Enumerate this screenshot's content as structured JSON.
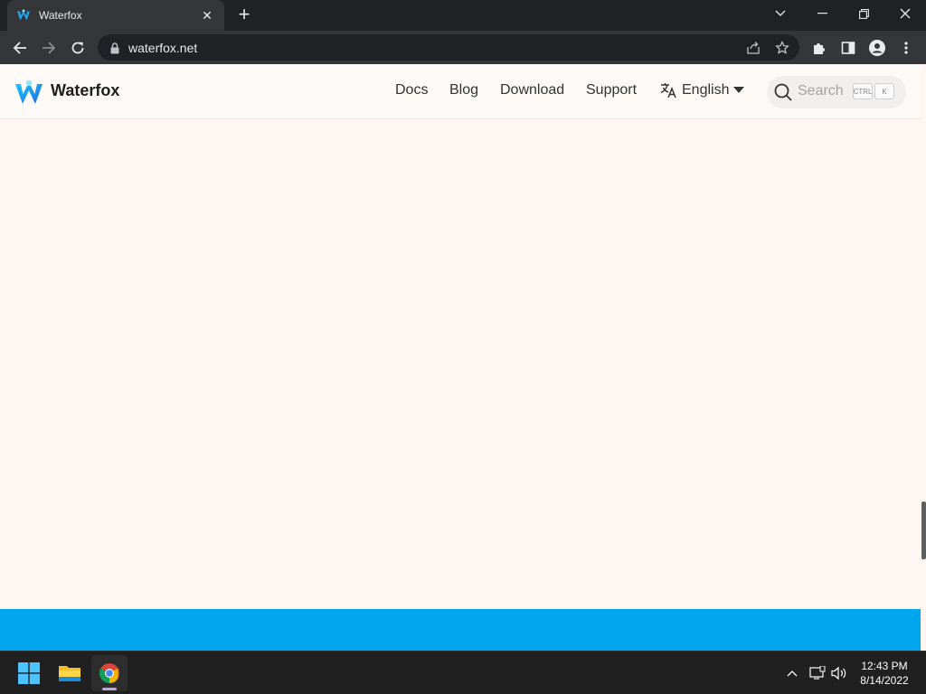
{
  "browser": {
    "tab": {
      "title": "Waterfox"
    },
    "address_bar": {
      "url": "waterfox.net"
    }
  },
  "site": {
    "brand": "Waterfox",
    "nav": [
      {
        "label": "Docs"
      },
      {
        "label": "Blog"
      },
      {
        "label": "Download"
      },
      {
        "label": "Support"
      }
    ],
    "language": {
      "label": "English"
    },
    "search": {
      "placeholder": "Search",
      "shortcut_keys": [
        "CTRL",
        "K"
      ]
    },
    "colors": {
      "accent_band": "#00a6ed",
      "page_background": "#fdf6f3"
    }
  },
  "taskbar": {
    "clock": {
      "time": "12:43 PM",
      "date": "8/14/2022"
    }
  },
  "icons": [
    "waterfox-logo-icon",
    "close-icon",
    "plus-icon",
    "chevron-down-icon",
    "minimize-icon",
    "restore-icon",
    "back-arrow-icon",
    "forward-arrow-icon",
    "reload-icon",
    "lock-icon",
    "share-icon",
    "star-icon",
    "puzzle-icon",
    "side-panel-icon",
    "profile-icon",
    "kebab-menu-icon",
    "translate-icon",
    "caret-down-icon",
    "search-icon",
    "windows-start-icon",
    "file-explorer-icon",
    "chrome-icon",
    "chevron-up-icon",
    "network-icon",
    "volume-icon"
  ]
}
